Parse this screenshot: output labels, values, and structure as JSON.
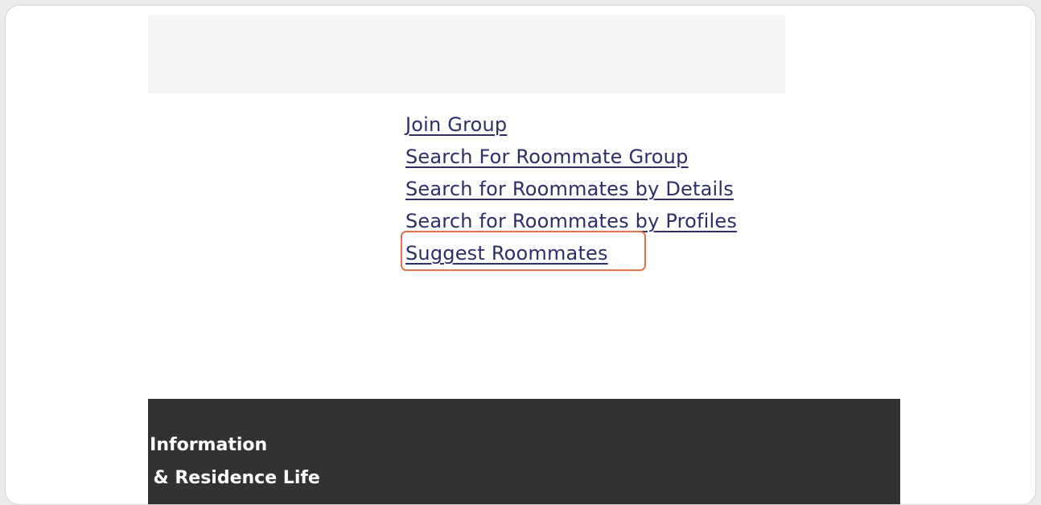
{
  "links": [
    {
      "label": "Join Group"
    },
    {
      "label": "Search For Roommate Group"
    },
    {
      "label": "Search for Roommates by Details"
    },
    {
      "label": "Search for Roommates by Profiles"
    },
    {
      "label": "Suggest Roommates"
    }
  ],
  "footer": {
    "line1": "t Information",
    "line2": "a & Residence Life"
  },
  "colors": {
    "link": "#2c2f66",
    "highlight": "#e0714c",
    "footer_bg": "#323232",
    "header_bg": "#f5f5f5"
  }
}
